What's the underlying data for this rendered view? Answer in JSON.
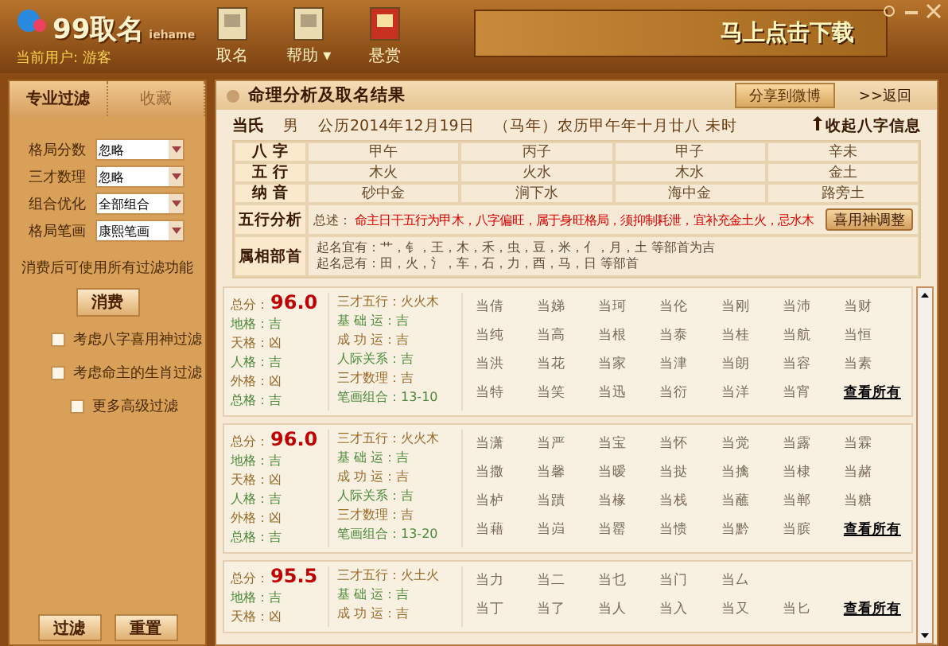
{
  "header": {
    "logo": "99取名",
    "logo_sub": "iehame",
    "user": "当前用户: 游客",
    "nav": [
      {
        "label": "取名",
        "selected": false
      },
      {
        "label": "帮助",
        "dropdown": "▾",
        "selected": false
      },
      {
        "label": "悬赏",
        "selected": false
      }
    ],
    "banner": "马上点击下载"
  },
  "sidebar": {
    "tabs": [
      {
        "label": "专业过滤",
        "selected": true
      },
      {
        "label": "收藏",
        "selected": false
      }
    ],
    "filters": [
      {
        "label": "格局分数",
        "value": "忽略"
      },
      {
        "label": "三才数理",
        "value": "忽略"
      },
      {
        "label": "组合优化",
        "value": "全部组合"
      },
      {
        "label": "格局笔画",
        "value": "康熙笔画"
      }
    ],
    "note": "消费后可使用所有过滤功能",
    "pay_button": "消费",
    "checks": [
      {
        "label": "考虑八字喜用神过滤",
        "checked": false,
        "indent": false
      },
      {
        "label": "考虑命主的生肖过滤",
        "checked": false,
        "indent": false
      },
      {
        "label": "更多高级过滤",
        "checked": false,
        "indent": true
      }
    ],
    "buttons": [
      "过滤",
      "重置"
    ]
  },
  "main": {
    "title": "命理分析及取名结果",
    "share": "分享到微博",
    "back": ">>返回",
    "info": {
      "surname": "当氏",
      "gender": "男",
      "solar": "公历2014年12月19日",
      "zodiac": "（马年）农历甲午年十月廿八  未时",
      "collapse": "收起八字信息"
    },
    "table": [
      {
        "label": "八 字",
        "cells": [
          "甲午",
          "丙子",
          "甲子",
          "辛未"
        ]
      },
      {
        "label": "五 行",
        "cells": [
          "木火",
          "火水",
          "木水",
          "金土"
        ]
      },
      {
        "label": "纳 音",
        "cells": [
          "砂中金",
          "涧下水",
          "海中金",
          "路旁土"
        ]
      }
    ],
    "wuxing": {
      "label": "五行分析",
      "prefix": "总述：",
      "text": "命主日干五行为甲木，八字偏旺，属于身旺格局，须抑制耗泄，宜补充金土火，忌水木",
      "button": "喜用神调整"
    },
    "radicals": {
      "label": "属相部首",
      "lines": [
        "起名宜有：艹，钅，王，木，禾，虫，豆，米，亻，月，土  等部首为吉",
        "起名忌有：田，火，氵，车，石，力，酉，马，日  等部首"
      ]
    },
    "cards": [
      {
        "score_label": "总分：",
        "score": "96.0",
        "left": [
          {
            "text": "地格：吉",
            "good": true
          },
          {
            "text": "天格：凶",
            "good": false
          },
          {
            "text": "人格：吉",
            "good": true
          },
          {
            "text": "外格：凶",
            "good": false
          },
          {
            "text": "总格：吉",
            "good": true
          }
        ],
        "mid": [
          {
            "text": "三才五行：火火木",
            "good": false
          },
          {
            "text": "基 础 运：吉",
            "good": true
          },
          {
            "text": "成 功 运：吉",
            "good": false
          },
          {
            "text": "人际关系：吉",
            "good": true
          },
          {
            "text": "三才数理：吉",
            "good": false
          },
          {
            "text": "笔画组合：13-10",
            "good": true
          }
        ],
        "names": [
          [
            "当倩",
            "当娣",
            "当珂",
            "当伦",
            "当刚",
            "当沛",
            "当财"
          ],
          [
            "当纯",
            "当高",
            "当根",
            "当泰",
            "当桂",
            "当航",
            "当恒"
          ],
          [
            "当洪",
            "当花",
            "当家",
            "当津",
            "当朗",
            "当容",
            "当素"
          ],
          [
            "当特",
            "当笑",
            "当迅",
            "当衍",
            "当洋",
            "当宵"
          ]
        ],
        "more": "查看所有"
      },
      {
        "score_label": "总分：",
        "score": "96.0",
        "left": [
          {
            "text": "地格：吉",
            "good": true
          },
          {
            "text": "天格：凶",
            "good": false
          },
          {
            "text": "人格：吉",
            "good": true
          },
          {
            "text": "外格：凶",
            "good": false
          },
          {
            "text": "总格：吉",
            "good": true
          }
        ],
        "mid": [
          {
            "text": "三才五行：火火木",
            "good": false
          },
          {
            "text": "基 础 运：吉",
            "good": true
          },
          {
            "text": "成 功 运：吉",
            "good": false
          },
          {
            "text": "人际关系：吉",
            "good": true
          },
          {
            "text": "三才数理：吉",
            "good": false
          },
          {
            "text": "笔画组合：13-20",
            "good": true
          }
        ],
        "names": [
          [
            "当潇",
            "当严",
            "当宝",
            "当怀",
            "当觉",
            "当露",
            "当霖"
          ],
          [
            "当撒",
            "当馨",
            "当暧",
            "当挞",
            "当擒",
            "当棣",
            "当赭"
          ],
          [
            "当栌",
            "当蹟",
            "当椽",
            "当栈",
            "当蘸",
            "当郸",
            "当糖"
          ],
          [
            "当藉",
            "当岿",
            "当罂",
            "当愦",
            "当黔",
            "当膑"
          ]
        ],
        "more": "查看所有"
      },
      {
        "score_label": "总分：",
        "score": "95.5",
        "left": [
          {
            "text": "地格：吉",
            "good": true
          },
          {
            "text": "天格：凶",
            "good": false
          }
        ],
        "mid": [
          {
            "text": "三才五行：火土火",
            "good": false
          },
          {
            "text": "基 础 运：吉",
            "good": true
          },
          {
            "text": "成 功 运：吉",
            "good": false
          }
        ],
        "names": [
          [
            "当力",
            "当二",
            "当乜",
            "当门",
            "当厶"
          ],
          [
            "当丁",
            "当了",
            "当人",
            "当入",
            "当又",
            "当匕"
          ]
        ],
        "more": "查看所有"
      }
    ]
  }
}
